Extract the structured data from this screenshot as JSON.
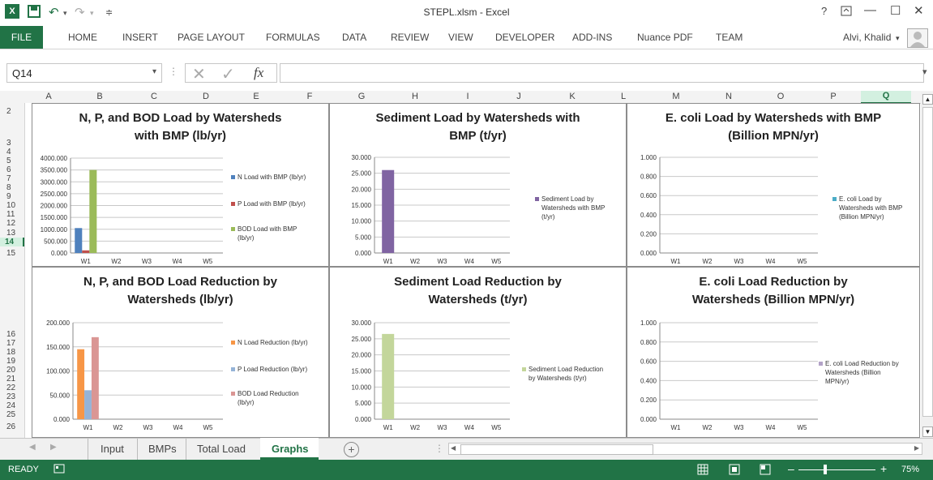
{
  "app": {
    "title": "STEPL.xlsm - Excel",
    "user": "Alvi, Khalid"
  },
  "ribbon": {
    "tabs": [
      "FILE",
      "HOME",
      "INSERT",
      "PAGE LAYOUT",
      "FORMULAS",
      "DATA",
      "REVIEW",
      "VIEW",
      "DEVELOPER",
      "ADD-INS",
      "Nuance PDF",
      "TEAM"
    ]
  },
  "formula_bar": {
    "name_box": "Q14",
    "fx_label": "fx",
    "value": ""
  },
  "grid": {
    "columns": [
      "A",
      "B",
      "C",
      "D",
      "E",
      "F",
      "G",
      "H",
      "I",
      "J",
      "K",
      "L",
      "M",
      "N",
      "O",
      "P",
      "Q"
    ],
    "selected_column": "Q",
    "rows": [
      "2",
      "3",
      "4",
      "5",
      "6",
      "7",
      "8",
      "9",
      "10",
      "11",
      "12",
      "13",
      "14",
      "15",
      "16",
      "17",
      "18",
      "19",
      "20",
      "21",
      "22",
      "23",
      "24",
      "25",
      "26"
    ],
    "selected_row": "14"
  },
  "colors": {
    "accent": "#217346",
    "n": "#4f81bd",
    "p": "#c0504d",
    "bod": "#9bbb59",
    "sed": "#8064a2",
    "ecoli": "#4bacc6",
    "n_red": "#f79646",
    "p_red": "#95b3d7",
    "bod_red": "#da9694",
    "sed_red": "#c3d69b",
    "ecoli_red": "#b2a2c7"
  },
  "chart_data": [
    {
      "type": "bar",
      "title": "N, P, and BOD Load by Watersheds with BMP (lb/yr)",
      "title_lines": [
        "N, P, and BOD Load by Watersheds",
        "with BMP (lb/yr)"
      ],
      "categories": [
        "W1",
        "W2",
        "W3",
        "W4",
        "W5"
      ],
      "ylim": [
        0,
        4000
      ],
      "yticks": [
        "0.000",
        "500.000",
        "1000.000",
        "1500.000",
        "2000.000",
        "2500.000",
        "3000.000",
        "3500.000",
        "4000.000"
      ],
      "series": [
        {
          "name": "N Load with BMP (lb/yr)",
          "legend_lines": [
            "N Load with BMP (lb/yr)"
          ],
          "values": [
            1050,
            0,
            0,
            0,
            0
          ],
          "color": "#4f81bd"
        },
        {
          "name": "P Load with BMP (lb/yr)",
          "legend_lines": [
            "P Load with BMP (lb/yr)"
          ],
          "values": [
            110,
            0,
            0,
            0,
            0
          ],
          "color": "#c0504d"
        },
        {
          "name": "BOD Load with BMP (lb/yr)",
          "legend_lines": [
            "BOD Load with BMP",
            "(lb/yr)"
          ],
          "values": [
            3500,
            0,
            0,
            0,
            0
          ],
          "color": "#9bbb59"
        }
      ]
    },
    {
      "type": "bar",
      "title": "Sediment Load by Watersheds with BMP (t/yr)",
      "title_lines": [
        "Sediment Load by Watersheds with",
        "BMP (t/yr)"
      ],
      "categories": [
        "W1",
        "W2",
        "W3",
        "W4",
        "W5"
      ],
      "ylim": [
        0,
        30
      ],
      "yticks": [
        "0.000",
        "5.000",
        "10.000",
        "15.000",
        "20.000",
        "25.000",
        "30.000"
      ],
      "series": [
        {
          "name": "Sediment Load by Watersheds with BMP (t/yr)",
          "legend_lines": [
            "Sediment Load by",
            "Watersheds with BMP",
            "(t/yr)"
          ],
          "values": [
            26,
            0,
            0,
            0,
            0
          ],
          "color": "#8064a2"
        }
      ]
    },
    {
      "type": "bar",
      "title": "E. coli Load by Watersheds with BMP (Billion MPN/yr)",
      "title_lines": [
        "E. coli Load by Watersheds with BMP",
        "(Billion MPN/yr)"
      ],
      "categories": [
        "W1",
        "W2",
        "W3",
        "W4",
        "W5"
      ],
      "ylim": [
        0,
        1
      ],
      "yticks": [
        "0.000",
        "0.200",
        "0.400",
        "0.600",
        "0.800",
        "1.000"
      ],
      "series": [
        {
          "name": "E. coli Load by Watersheds with BMP (Billion MPN/yr)",
          "legend_lines": [
            "E. coli Load by",
            "Watersheds with BMP",
            "(Billion MPN/yr)"
          ],
          "values": [
            0,
            0,
            0,
            0,
            0
          ],
          "color": "#4bacc6"
        }
      ]
    },
    {
      "type": "bar",
      "title": "N, P, and BOD Load Reduction by Watersheds (lb/yr)",
      "title_lines": [
        "N, P, and BOD Load Reduction by",
        "Watersheds (lb/yr)"
      ],
      "categories": [
        "W1",
        "W2",
        "W3",
        "W4",
        "W5"
      ],
      "ylim": [
        0,
        200
      ],
      "yticks": [
        "0.000",
        "50.000",
        "100.000",
        "150.000",
        "200.000"
      ],
      "series": [
        {
          "name": "N Load Reduction (lb/yr)",
          "legend_lines": [
            "N Load Reduction (lb/yr)"
          ],
          "values": [
            145,
            0,
            0,
            0,
            0
          ],
          "color": "#f79646"
        },
        {
          "name": "P Load Reduction (lb/yr)",
          "legend_lines": [
            "P Load Reduction (lb/yr)"
          ],
          "values": [
            60,
            0,
            0,
            0,
            0
          ],
          "color": "#95b3d7"
        },
        {
          "name": "BOD Load Reduction (lb/yr)",
          "legend_lines": [
            "BOD Load Reduction",
            "(lb/yr)"
          ],
          "values": [
            170,
            0,
            0,
            0,
            0
          ],
          "color": "#da9694"
        }
      ]
    },
    {
      "type": "bar",
      "title": "Sediment Load Reduction by Watersheds (t/yr)",
      "title_lines": [
        "Sediment Load Reduction by",
        "Watersheds (t/yr)"
      ],
      "categories": [
        "W1",
        "W2",
        "W3",
        "W4",
        "W5"
      ],
      "ylim": [
        0,
        30
      ],
      "yticks": [
        "0.000",
        "5.000",
        "10.000",
        "15.000",
        "20.000",
        "25.000",
        "30.000"
      ],
      "series": [
        {
          "name": "Sediment Load Reduction by Watersheds (t/yr)",
          "legend_lines": [
            "Sediment Load Reduction",
            "by Watersheds (t/yr)"
          ],
          "values": [
            26.5,
            0,
            0,
            0,
            0
          ],
          "color": "#c3d69b"
        }
      ]
    },
    {
      "type": "bar",
      "title": "E. coli Load Reduction by Watersheds (Billion MPN/yr)",
      "title_lines": [
        "E. coli Load Reduction by",
        "Watersheds (Billion MPN/yr)"
      ],
      "categories": [
        "W1",
        "W2",
        "W3",
        "W4",
        "W5"
      ],
      "ylim": [
        0,
        1
      ],
      "yticks": [
        "0.000",
        "0.200",
        "0.400",
        "0.600",
        "0.800",
        "1.000"
      ],
      "series": [
        {
          "name": "E. coli Load Reduction by Watersheds (Billion MPN/yr)",
          "legend_lines": [
            "E. coli Load Reduction by",
            "Watersheds (Billion",
            "MPN/yr)"
          ],
          "values": [
            0,
            0,
            0,
            0,
            0
          ],
          "color": "#b2a2c7"
        }
      ]
    }
  ],
  "sheets": {
    "tabs": [
      "Input",
      "BMPs",
      "Total Load",
      "Graphs"
    ],
    "active": "Graphs"
  },
  "status": {
    "mode": "READY",
    "zoom": "75%"
  },
  "icons": {
    "excel": "excel-logo-icon",
    "save": "save-icon",
    "undo": "undo-icon",
    "redo": "redo-icon"
  }
}
